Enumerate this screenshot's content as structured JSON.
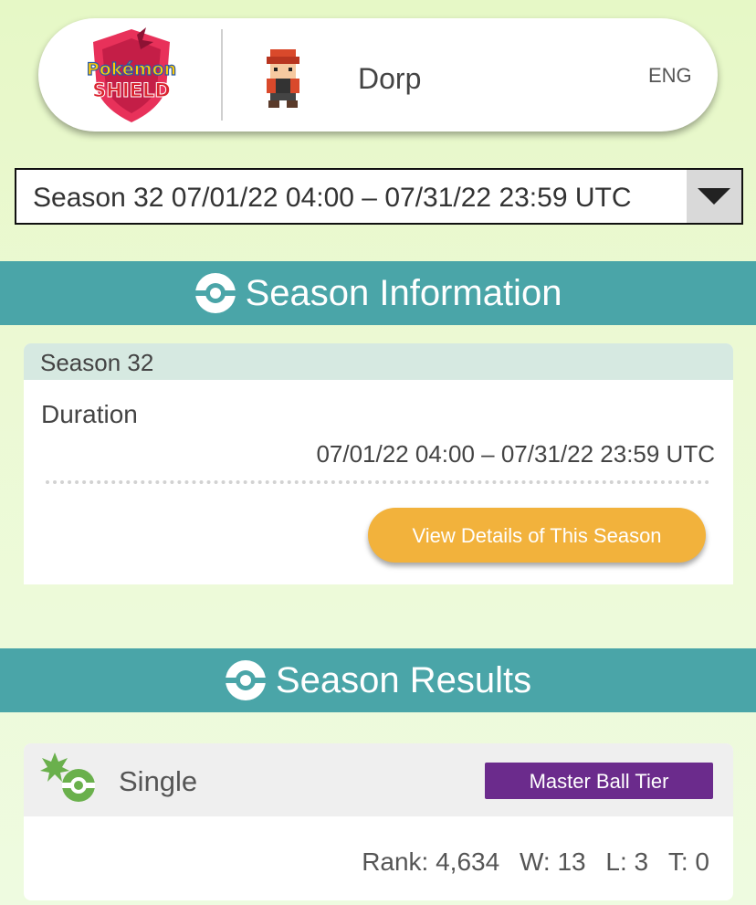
{
  "header": {
    "logo_text": "POKÉMON SHIELD",
    "player_name": "Dorp",
    "language": "ENG"
  },
  "season_select": {
    "selected": "Season 32 07/01/22 04:00 – 07/31/22 23:59 UTC"
  },
  "season_info": {
    "section_title": "Season Information",
    "season_label": "Season 32",
    "duration_label": "Duration",
    "duration_value": "07/01/22 04:00 – 07/31/22 23:59 UTC",
    "details_button": "View Details of This Season"
  },
  "season_results": {
    "section_title": "Season Results",
    "battle_type": "Single",
    "tier": "Master Ball Tier",
    "rank": "Rank: 4,634",
    "wins": "W: 13",
    "losses": "L: 3",
    "ties": "T: 0"
  },
  "colors": {
    "background": "#e6f8c6",
    "section_bar": "#4aa5a8",
    "button": "#f2b23c",
    "tier_badge": "#6b2b8c",
    "battle_icon": "#6ab04c"
  },
  "icons": [
    "pokemon-shield-logo",
    "trainer-sprite-icon",
    "dropdown-arrow-icon",
    "pokeball-icon",
    "battle-single-icon"
  ]
}
